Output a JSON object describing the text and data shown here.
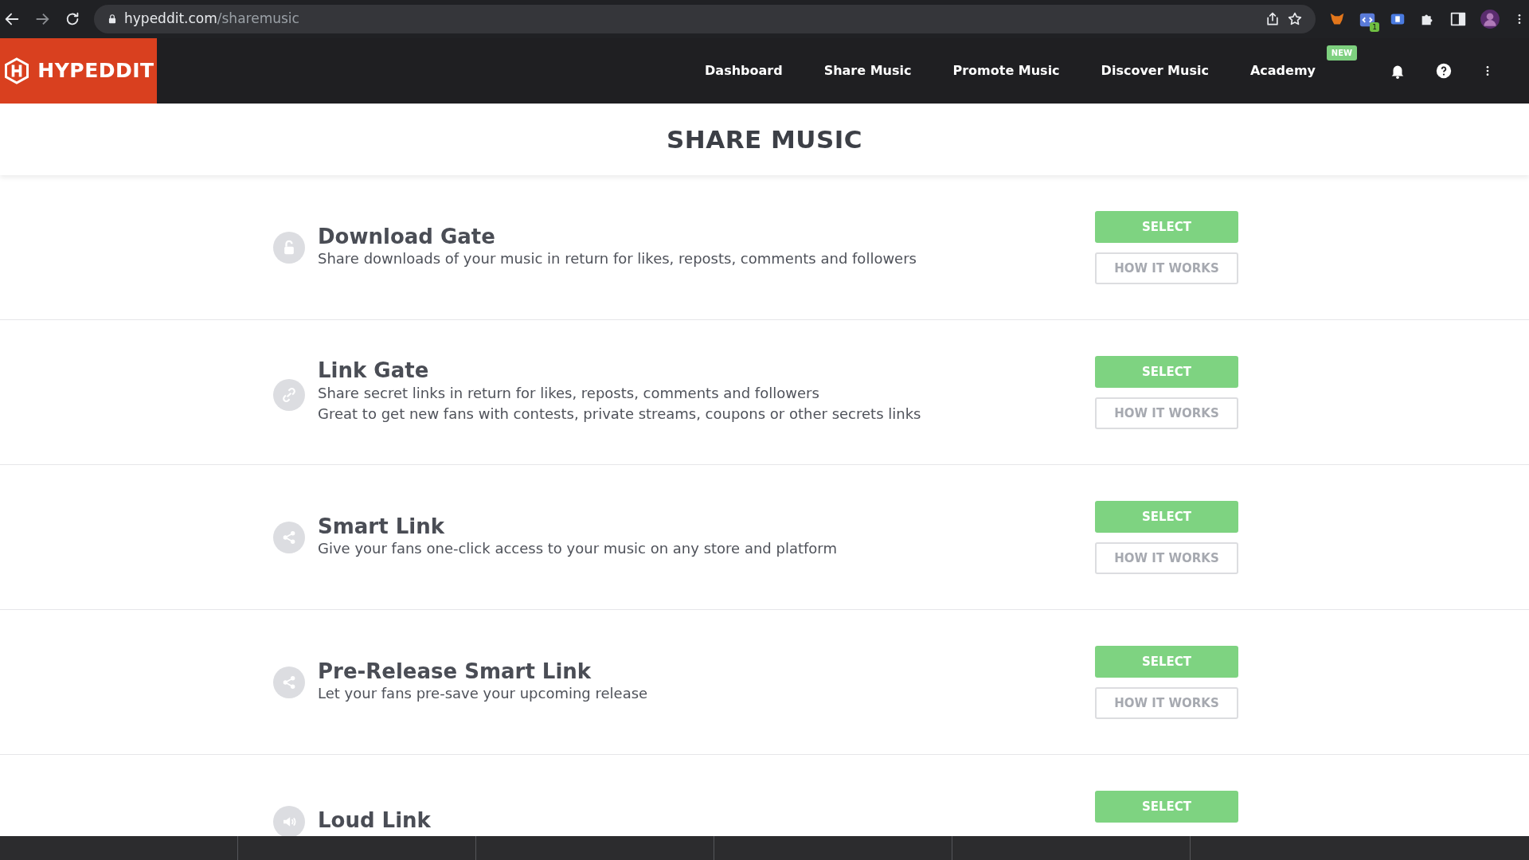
{
  "browser": {
    "url_domain": "hypeddit.com",
    "url_path": "/sharemusic",
    "extension_badge": "1"
  },
  "header": {
    "logo": "HYPEDDIT",
    "nav": [
      {
        "label": "Dashboard"
      },
      {
        "label": "Share Music"
      },
      {
        "label": "Promote Music"
      },
      {
        "label": "Discover Music"
      },
      {
        "label": "Academy",
        "badge": "NEW"
      }
    ]
  },
  "page_title": "SHARE MUSIC",
  "options": [
    {
      "kind": "lock",
      "title": "Download Gate",
      "lines": [
        "Share downloads of your music in return for likes, reposts, comments and followers"
      ],
      "buttons": [
        "SELECT",
        "HOW IT WORKS"
      ]
    },
    {
      "kind": "link",
      "title": "Link Gate",
      "lines": [
        "Share secret links in return for likes, reposts, comments and followers",
        "Great to get new fans with contests, private streams, coupons or other secrets links"
      ],
      "buttons": [
        "SELECT",
        "HOW IT WORKS"
      ]
    },
    {
      "kind": "share",
      "title": "Smart Link",
      "lines": [
        "Give your fans one-click access to your music on any store and platform"
      ],
      "buttons": [
        "SELECT",
        "HOW IT WORKS"
      ]
    },
    {
      "kind": "share",
      "title": "Pre-Release Smart Link",
      "lines": [
        "Let your fans pre-save your upcoming release"
      ],
      "buttons": [
        "SELECT",
        "HOW IT WORKS"
      ]
    },
    {
      "kind": "speaker",
      "title": "Loud Link",
      "buttons": [
        "SELECT"
      ]
    }
  ]
}
